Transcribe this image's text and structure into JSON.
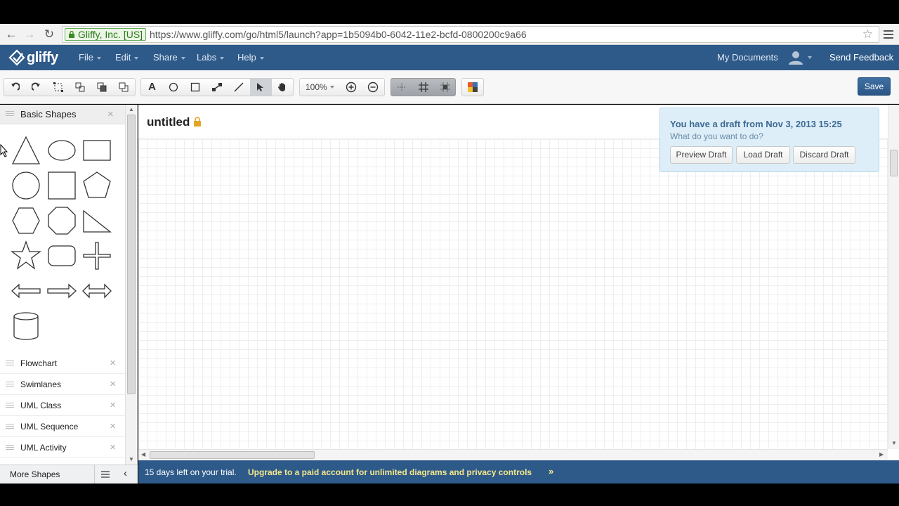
{
  "browser": {
    "cert_label": "Gliffy, Inc. [US]",
    "url": "https://www.gliffy.com/go/html5/launch?app=1b5094b0-6042-11e2-bcfd-0800200c9a66"
  },
  "header": {
    "logo_text": "gliffy",
    "menus": [
      "File",
      "Edit",
      "Share",
      "Labs",
      "Help"
    ],
    "my_documents": "My Documents",
    "send_feedback": "Send Feedback"
  },
  "toolbar": {
    "zoom": "100%",
    "save_label": "Save"
  },
  "left_panel": {
    "palette_title": "Basic Shapes",
    "libraries": [
      "Flowchart",
      "Swimlanes",
      "UML Class",
      "UML Sequence",
      "UML Activity"
    ],
    "more_shapes": "More Shapes"
  },
  "canvas": {
    "doc_title": "untitled"
  },
  "draft": {
    "title": "You have a draft from Nov 3, 2013 15:25",
    "subtitle": "What do you want to do?",
    "preview": "Preview Draft",
    "load": "Load Draft",
    "discard": "Discard Draft"
  },
  "trial": {
    "text": "15 days left on your trial.",
    "upgrade": "Upgrade to a paid account for unlimited diagrams and privacy controls",
    "arrows": "»"
  },
  "colors": {
    "header_bg": "#2e5a8a",
    "draft_bg": "#ddeef8",
    "upgrade_link": "#f3e78a"
  }
}
